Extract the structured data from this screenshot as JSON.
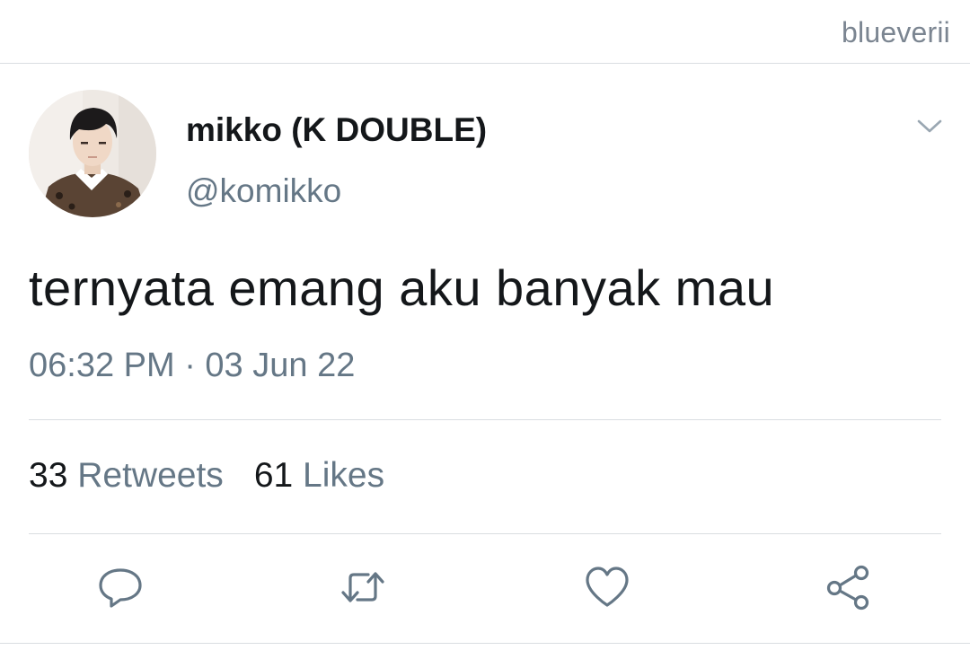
{
  "watermark": "blueverii",
  "tweet": {
    "author": {
      "display_name": "mikko (K DOUBLE)",
      "handle": "@komikko",
      "avatar": "profile-photo"
    },
    "text": "ternyata emang aku banyak mau",
    "timestamp": "06:32 PM · 03 Jun 22",
    "stats": {
      "retweets_count": "33",
      "retweets_label": "Retweets",
      "likes_count": "61",
      "likes_label": "Likes"
    },
    "actions": [
      {
        "name": "reply",
        "icon": "reply-icon"
      },
      {
        "name": "retweet",
        "icon": "retweet-icon"
      },
      {
        "name": "like",
        "icon": "heart-icon"
      },
      {
        "name": "share",
        "icon": "share-icon"
      }
    ]
  },
  "colors": {
    "primary_text": "#14171a",
    "secondary_text": "#657786",
    "icon_gray": "#657786",
    "divider": "#d9dde1",
    "watermark": "#7b8591"
  }
}
